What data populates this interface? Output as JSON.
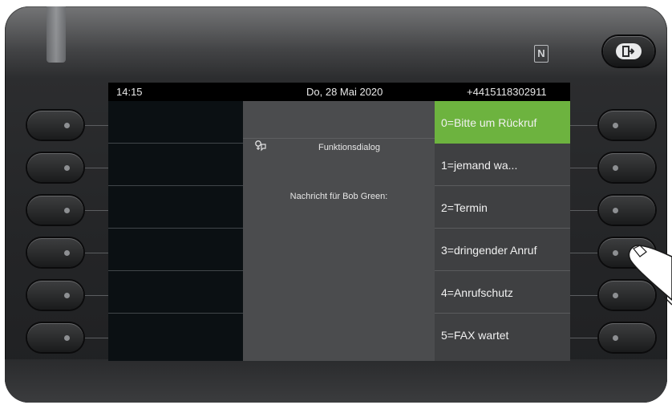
{
  "status_bar": {
    "time": "14:15",
    "date": "Do, 28 Mai 2020",
    "number": "+4415118302911"
  },
  "dialog": {
    "title": "Funktionsdialog",
    "message": "Nachricht für Bob Green:"
  },
  "options": [
    {
      "label": "0=Bitte um Rückruf",
      "selected": true
    },
    {
      "label": "1=jemand wa...",
      "selected": false
    },
    {
      "label": "2=Termin",
      "selected": false
    },
    {
      "label": "3=dringender Anruf",
      "selected": false
    },
    {
      "label": "4=Anrufschutz",
      "selected": false
    },
    {
      "label": "5=FAX wartet",
      "selected": false
    }
  ],
  "icons": {
    "nfc": "nfc-icon",
    "logout": "logout-icon",
    "dialog": "dialog-icon",
    "finger": "pointing-finger-icon"
  },
  "colors": {
    "selected": "#6db33f",
    "screen_bg": "#3c3d3f",
    "status_bg": "#000000"
  }
}
